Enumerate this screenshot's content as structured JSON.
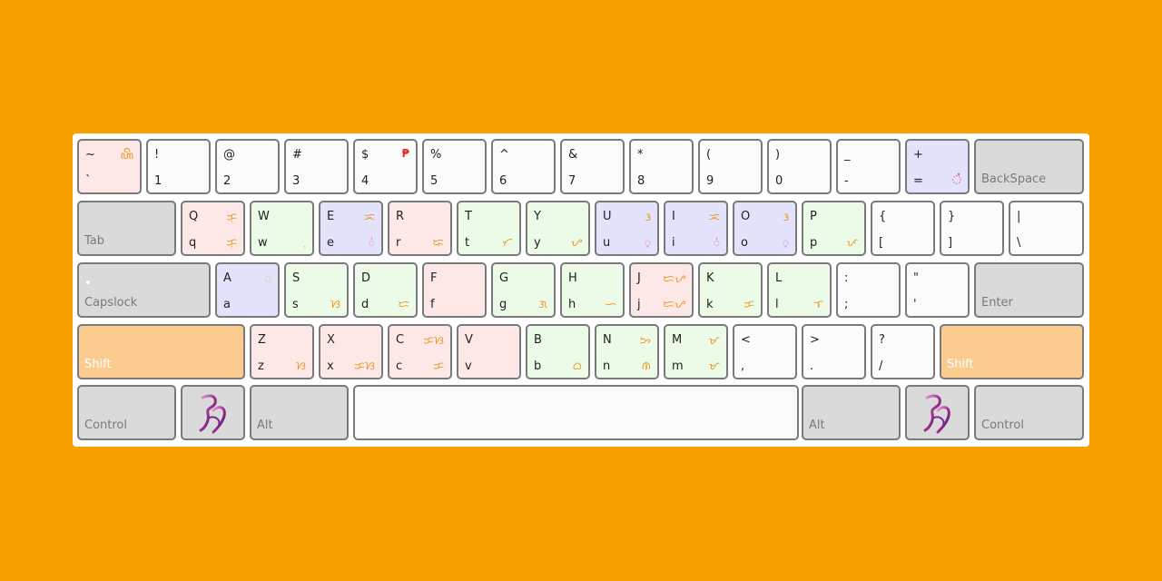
{
  "keyboard": {
    "row1": [
      {
        "top": "~",
        "bot": "`",
        "gtop": "ꦲꦼ",
        "gbot": ""
      },
      {
        "top": "!",
        "bot": "1"
      },
      {
        "top": "@",
        "bot": "2"
      },
      {
        "top": "#",
        "bot": "3"
      },
      {
        "top": "$",
        "bot": "4",
        "gtop": "₱"
      },
      {
        "top": "%",
        "bot": "5"
      },
      {
        "top": "^",
        "bot": "6"
      },
      {
        "top": "&",
        "bot": "7"
      },
      {
        "top": "*",
        "bot": "8"
      },
      {
        "top": "(",
        "bot": "9"
      },
      {
        "top": ")",
        "bot": "0"
      },
      {
        "top": "_",
        "bot": "-"
      },
      {
        "top": "+",
        "bot": "=",
        "gbot": "◌̽"
      }
    ],
    "backspace": "BackSpace",
    "tab": "Tab",
    "row2": [
      {
        "top": "Q",
        "bot": "q",
        "gtop": "ᜃᜓ",
        "gbot": "ᜃᜓ"
      },
      {
        "top": "W",
        "bot": "w",
        "gbot": "ᜓ"
      },
      {
        "top": "E",
        "bot": "e",
        "gtop": "ᜁ",
        "gbot": "◌ᜒ"
      },
      {
        "top": "R",
        "bot": "r",
        "gbot": "ᜍ"
      },
      {
        "top": "T",
        "bot": "t",
        "gbot": "ᜆ"
      },
      {
        "top": "Y",
        "bot": "y",
        "gbot": "ᜌ"
      },
      {
        "top": "U",
        "bot": "u",
        "gtop": "ᜂ",
        "gbot": "◌ᜓ"
      },
      {
        "top": "I",
        "bot": "i",
        "gtop": "ᜁ",
        "gbot": "◌ᜒ"
      },
      {
        "top": "O",
        "bot": "o",
        "gtop": "ᜂ",
        "gbot": "◌ᜓ"
      },
      {
        "top": "P",
        "bot": "p",
        "gbot": "ᜉ"
      },
      {
        "top": "{",
        "bot": "["
      },
      {
        "top": "}",
        "bot": "]"
      },
      {
        "top": "|",
        "bot": "\\"
      }
    ],
    "capslock": "Capslock",
    "row3": [
      {
        "top": "A",
        "bot": "a",
        "gtop": "ᜀ"
      },
      {
        "top": "S",
        "bot": "s",
        "gbot": "ᜐ"
      },
      {
        "top": "D",
        "bot": "d",
        "gbot": "ᜇ"
      },
      {
        "top": "F",
        "bot": "f"
      },
      {
        "top": "G",
        "bot": "g",
        "gbot": "ᜄ"
      },
      {
        "top": "H",
        "bot": "h",
        "gbot": "ᜑ"
      },
      {
        "top": "J",
        "bot": "j",
        "gtop": "ᜇᜌ",
        "gbot": "ᜇᜌ"
      },
      {
        "top": "K",
        "bot": "k",
        "gbot": "ᜃ"
      },
      {
        "top": "L",
        "bot": "l",
        "gbot": "ᜎ"
      },
      {
        "top": ":",
        "bot": ";"
      },
      {
        "top": "\"",
        "bot": "'"
      }
    ],
    "enter": "Enter",
    "shift_left": "Shift",
    "row4": [
      {
        "top": "Z",
        "bot": "z",
        "gbot": "ᜐ"
      },
      {
        "top": "X",
        "bot": "x",
        "gbot": "ᜃᜐ"
      },
      {
        "top": "C",
        "bot": "c",
        "gtop": "ᜃᜐ",
        "gbot": "ᜃ"
      },
      {
        "top": "V",
        "bot": "v"
      },
      {
        "top": "B",
        "bot": "b",
        "gbot": "ᜊ"
      },
      {
        "top": "N",
        "bot": "n",
        "gtop": "ᜅ",
        "gbot": "ᜈ"
      },
      {
        "top": "M",
        "bot": "m",
        "gtop": "ᜋ",
        "gbot": "ᜋ"
      },
      {
        "top": "<",
        "bot": ","
      },
      {
        "top": ">",
        "bot": "."
      },
      {
        "top": "?",
        "bot": "/"
      }
    ],
    "shift_right": "Shift",
    "control_left": "Control",
    "alt_left": "Alt",
    "alt_right": "Alt",
    "control_right": "Control"
  },
  "colors": {
    "background": "#F9A000",
    "red_key": "#fde8e8",
    "green_key": "#ecfae8",
    "blue_key": "#e3e3fb",
    "modifier_key": "#dadada",
    "shift_key": "#FBCB8F",
    "glyph": "#E8931A"
  }
}
